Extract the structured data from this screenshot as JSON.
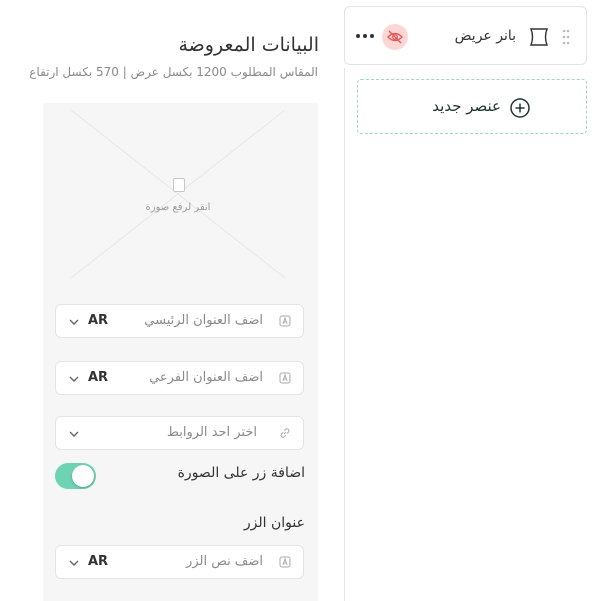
{
  "panel": {
    "title": "البيانات المعروضة",
    "subtitle": "المقاس المطلوب 1200 بكسل عرض | 570 بكسل ارتفاع",
    "upload_hint": "انقر لرفع صورة"
  },
  "fields": {
    "main_title": {
      "placeholder": "اضف العنوان الرئيسي",
      "lang": "AR",
      "icon": "text-icon"
    },
    "sub_title": {
      "placeholder": "اضف العنوان الفرعي",
      "lang": "AR",
      "icon": "text-icon"
    },
    "link": {
      "placeholder": "اختر احد الروابط",
      "icon": "link-icon"
    },
    "button_text": {
      "placeholder": "اضف نص الزر",
      "lang": "AR",
      "icon": "text-icon"
    }
  },
  "toggle": {
    "label": "اضافة زر على الصورة",
    "state": "on"
  },
  "button_section": {
    "title": "عنوان الزر"
  },
  "banner": {
    "label": "بانر عريض",
    "icon": "banner-icon"
  },
  "new_element": {
    "label": "عنصر جديد",
    "icon": "plus-circle-icon"
  },
  "colors": {
    "accent": "#6dd3b3",
    "hidden_badge": "#ffd6d6"
  }
}
